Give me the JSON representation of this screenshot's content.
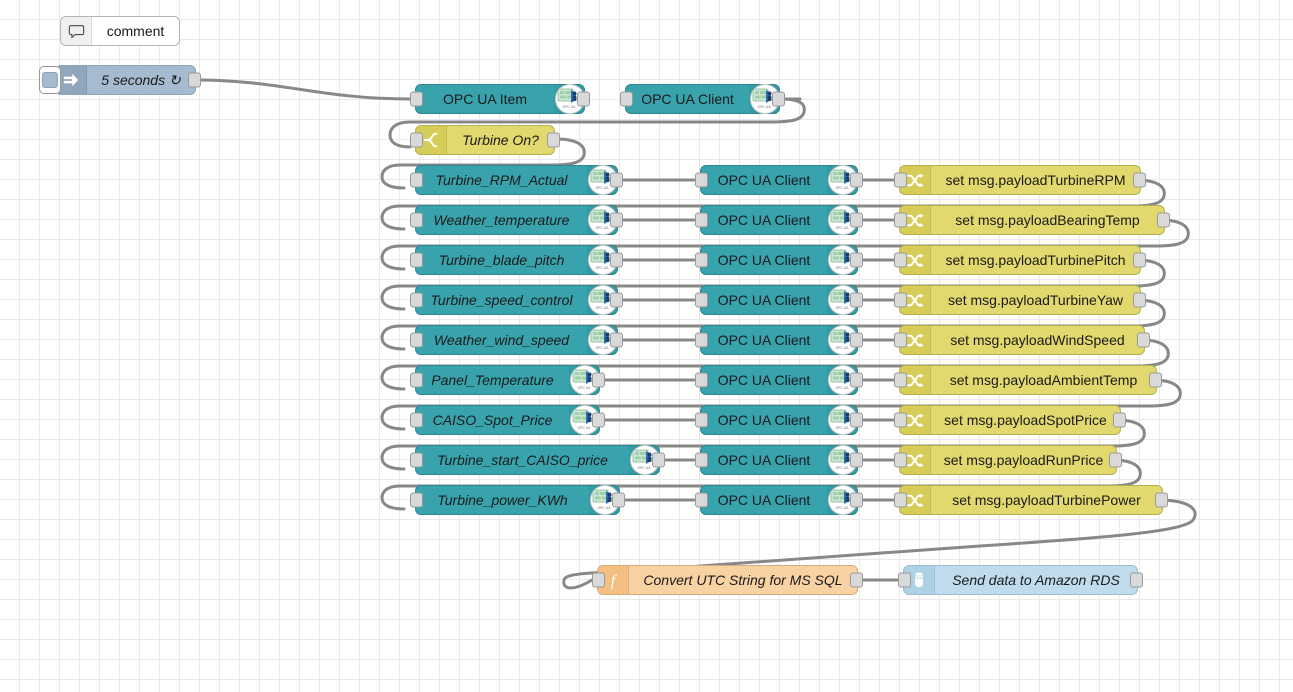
{
  "app": {
    "name": "Node-RED flow editor",
    "canvas_background": "#ffffff",
    "grid_color": "#e9e9e9",
    "wire_color": "#888888"
  },
  "palette": {
    "opcua_color": "#39a3ad",
    "change_color": "#e2d96e",
    "switch_color": "#e2d96e",
    "inject_color": "#a6bbcf",
    "function_color": "#f8d2a3",
    "database_color": "#c0dcec",
    "comment_color": "#ffffff"
  },
  "nodes": {
    "comment": {
      "label": "comment",
      "icon": "comment-bubble-icon"
    },
    "inject": {
      "label": "5 seconds ↻",
      "icon": "inject-arrow-icon"
    },
    "opcua_item": {
      "label": "OPC UA Item",
      "icon": "opc-ua-icon"
    },
    "opcua_client_top": {
      "label": "OPC UA Client",
      "icon": "opc-ua-icon"
    },
    "switch": {
      "label": "Turbine On?",
      "icon": "switch-icon"
    },
    "function": {
      "label": "Convert UTC String for MS SQL",
      "icon": "function-f-icon"
    },
    "database": {
      "label": "Send data to Amazon RDS",
      "icon": "database-cylinder-icon"
    },
    "client_label": "OPC UA Client"
  },
  "rows": [
    {
      "item": "Turbine_RPM_Actual",
      "client": "OPC UA Client",
      "change": "set msg.payloadTurbineRPM"
    },
    {
      "item": "Weather_temperature",
      "client": "OPC UA Client",
      "change": "set msg.payloadBearingTemp"
    },
    {
      "item": "Turbine_blade_pitch",
      "client": "OPC UA Client",
      "change": "set msg.payloadTurbinePitch"
    },
    {
      "item": "Turbine_speed_control",
      "client": "OPC UA Client",
      "change": "set msg.payloadTurbineYaw"
    },
    {
      "item": "Weather_wind_speed",
      "client": "OPC UA Client",
      "change": "set msg.payloadWindSpeed"
    },
    {
      "item": "Panel_Temperature",
      "client": "OPC UA Client",
      "change": "set msg.payloadAmbientTemp"
    },
    {
      "item": "CAISO_Spot_Price",
      "client": "OPC UA Client",
      "change": "set msg.payloadSpotPrice"
    },
    {
      "item": "Turbine_start_CAISO_price",
      "client": "OPC UA Client",
      "change": "set msg.payloadRunPrice"
    },
    {
      "item": "Turbine_power_KWh",
      "client": "OPC UA Client",
      "change": "set msg.payloadTurbinePower"
    }
  ]
}
